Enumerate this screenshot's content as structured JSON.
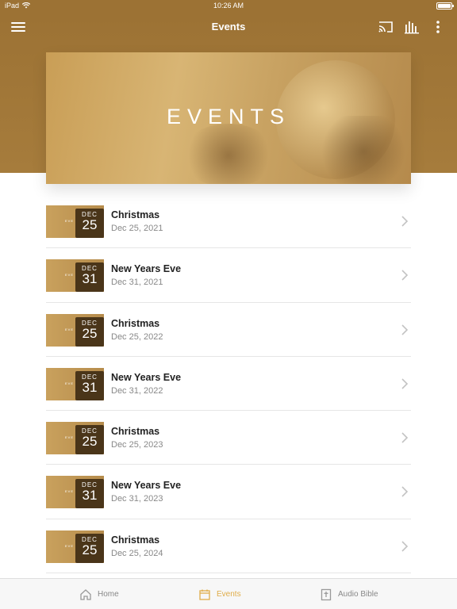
{
  "status_bar": {
    "device": "iPad",
    "time": "10:26 AM"
  },
  "nav": {
    "title": "Events"
  },
  "banner": {
    "title": "EVENTS"
  },
  "events": [
    {
      "title": "Christmas",
      "date": "Dec 25, 2021",
      "month": "DEC",
      "day": "25",
      "thumb_text": "EVE"
    },
    {
      "title": "New Years Eve",
      "date": "Dec 31, 2021",
      "month": "DEC",
      "day": "31",
      "thumb_text": "EVE"
    },
    {
      "title": "Christmas",
      "date": "Dec 25, 2022",
      "month": "DEC",
      "day": "25",
      "thumb_text": "EVE"
    },
    {
      "title": "New Years Eve",
      "date": "Dec 31, 2022",
      "month": "DEC",
      "day": "31",
      "thumb_text": "EVE"
    },
    {
      "title": "Christmas",
      "date": "Dec 25, 2023",
      "month": "DEC",
      "day": "25",
      "thumb_text": "EVE"
    },
    {
      "title": "New Years Eve",
      "date": "Dec 31, 2023",
      "month": "DEC",
      "day": "31",
      "thumb_text": "EVE"
    },
    {
      "title": "Christmas",
      "date": "Dec 25, 2024",
      "month": "DEC",
      "day": "25",
      "thumb_text": "EVE"
    }
  ],
  "tabs": [
    {
      "label": "Home",
      "icon": "home-icon"
    },
    {
      "label": "Events",
      "icon": "calendar-icon"
    },
    {
      "label": "Audio Bible",
      "icon": "bible-icon"
    }
  ],
  "colors": {
    "brand": "#9c7234",
    "accent_active_tab": "#e0ad4a",
    "badge": "#4a3519"
  }
}
